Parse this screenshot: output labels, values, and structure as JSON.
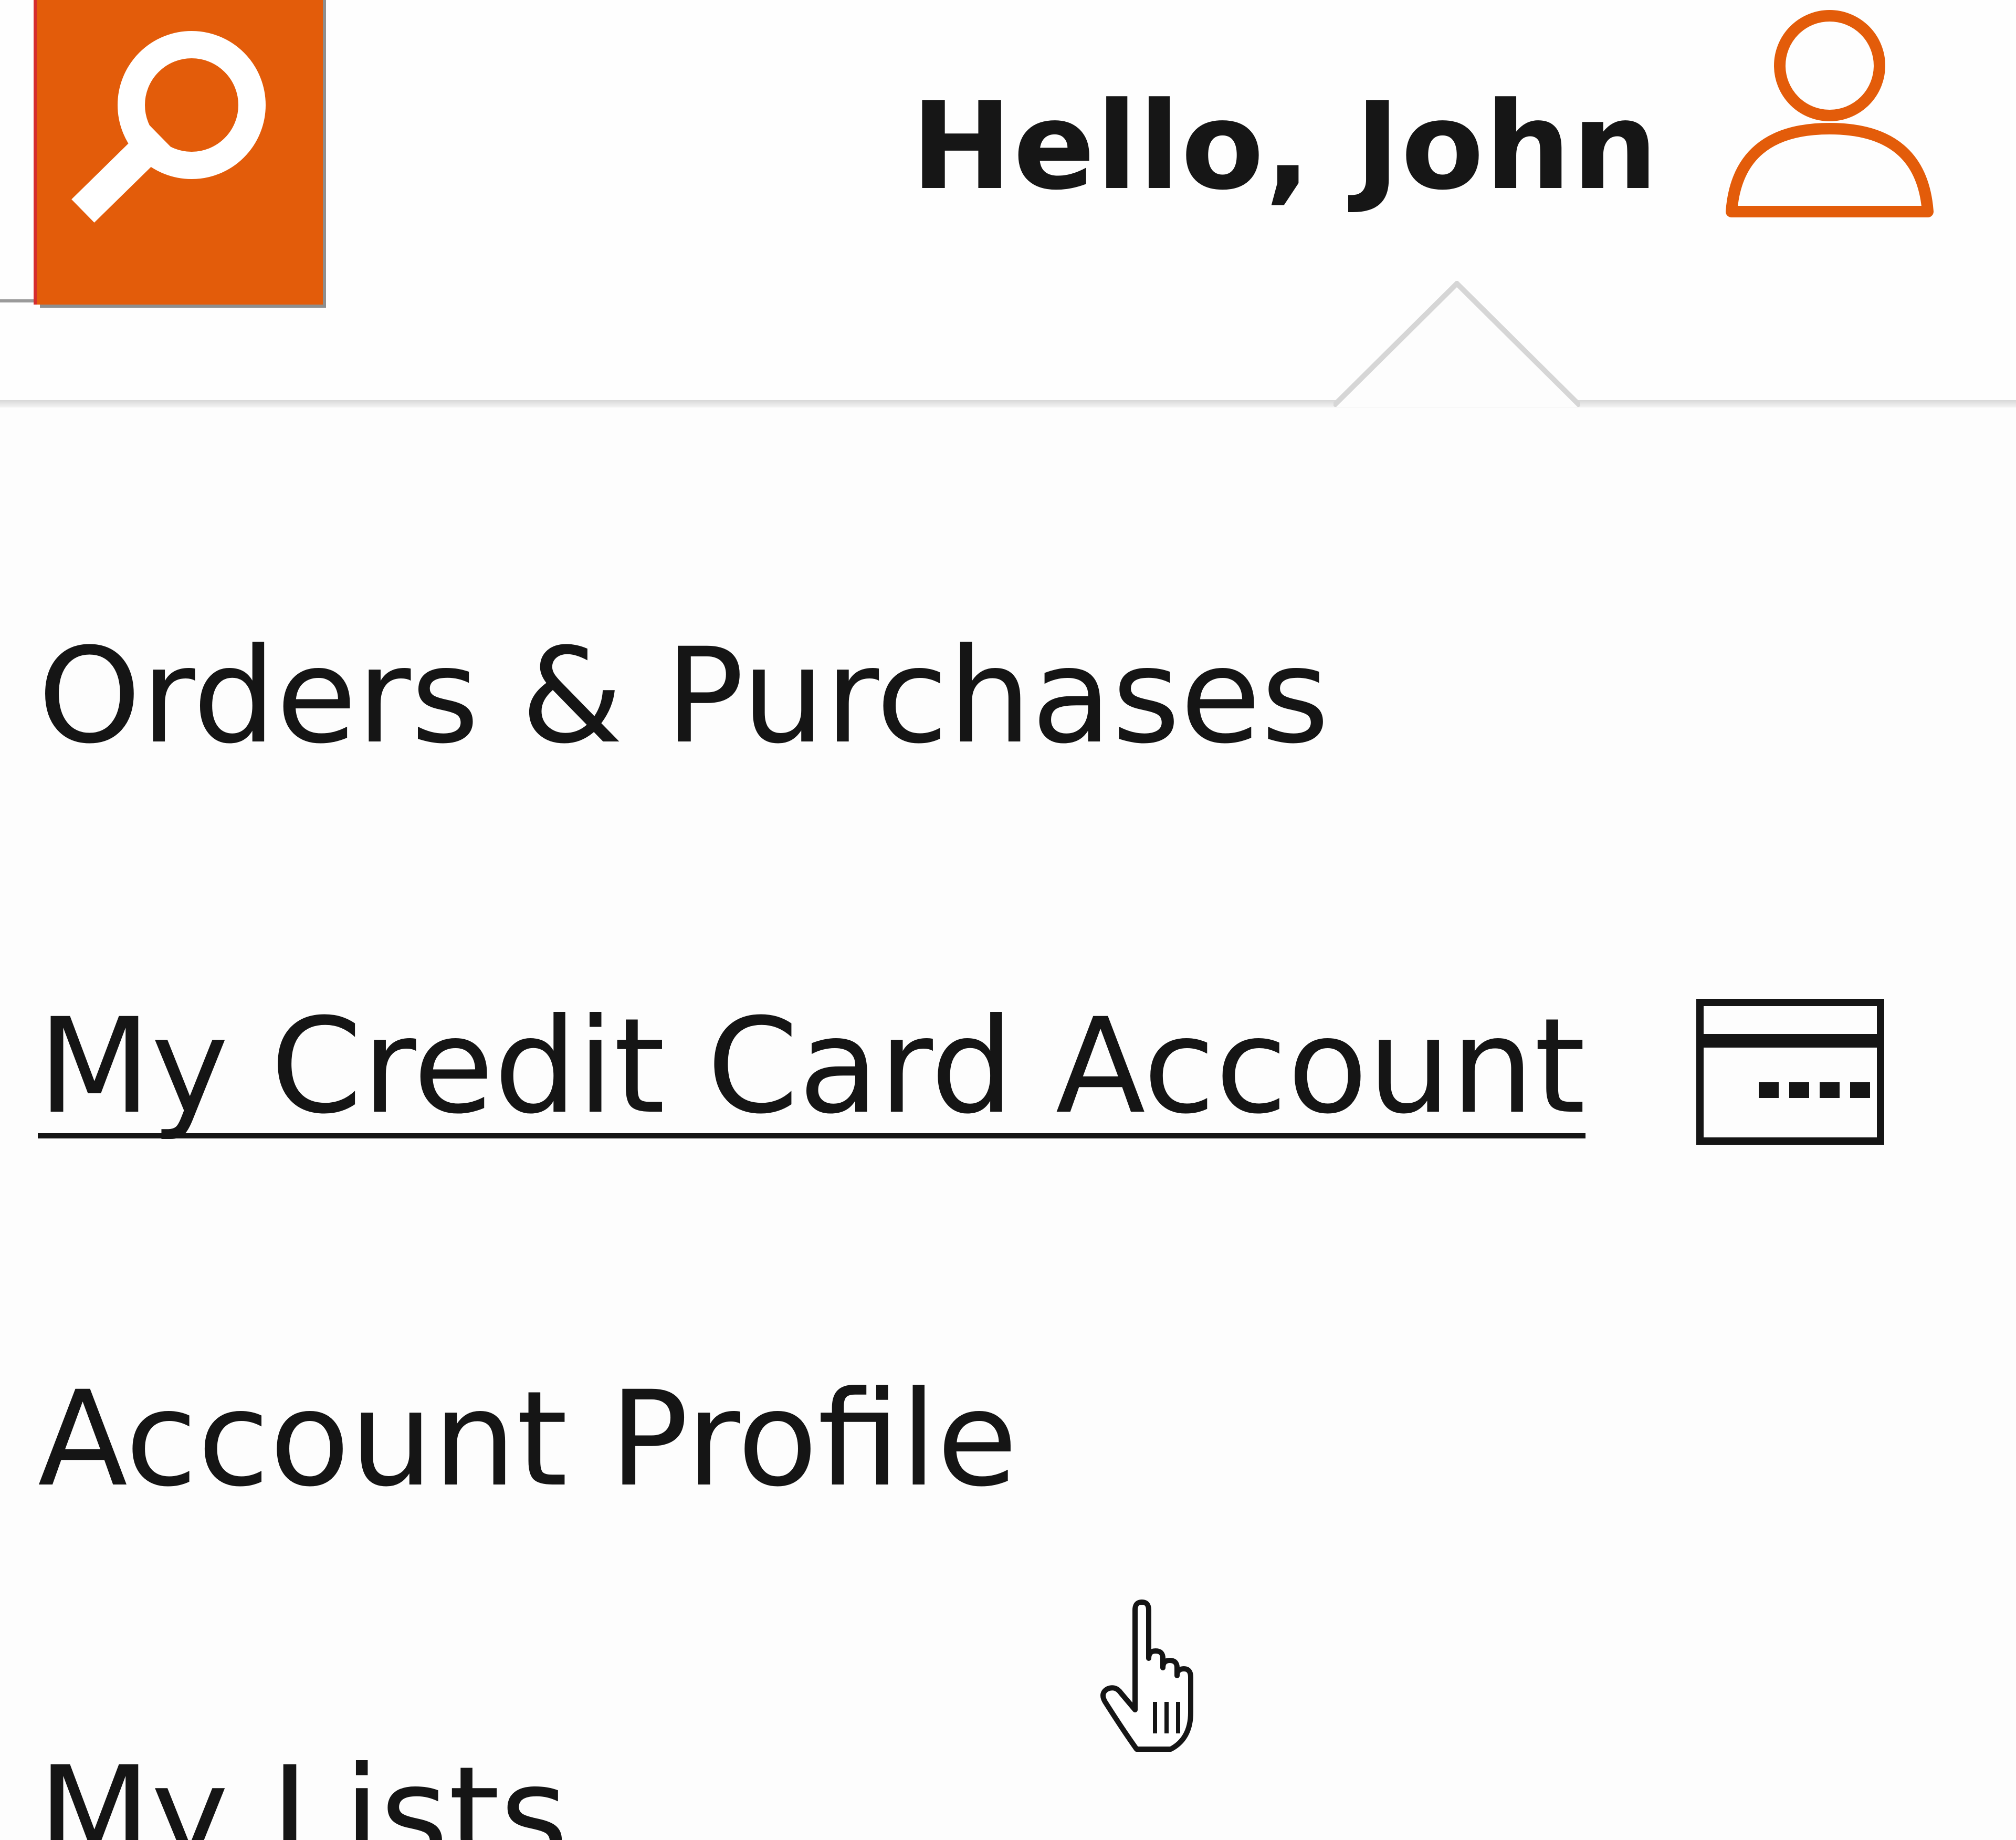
{
  "header": {
    "search_icon": "search-icon",
    "greeting": "Hello, John",
    "user_icon": "user-icon"
  },
  "account_menu": {
    "items": [
      {
        "label": "Orders & Purchases"
      },
      {
        "label": "My Credit Card Account",
        "icon": "credit-card-icon",
        "state": "hovered"
      },
      {
        "label": "Account Profile"
      },
      {
        "label": "My Lists"
      }
    ]
  },
  "cursor": "hand-pointer-icon",
  "colors": {
    "accent": "#e35c0a",
    "text": "#151515",
    "background": "#fdfdfd"
  }
}
